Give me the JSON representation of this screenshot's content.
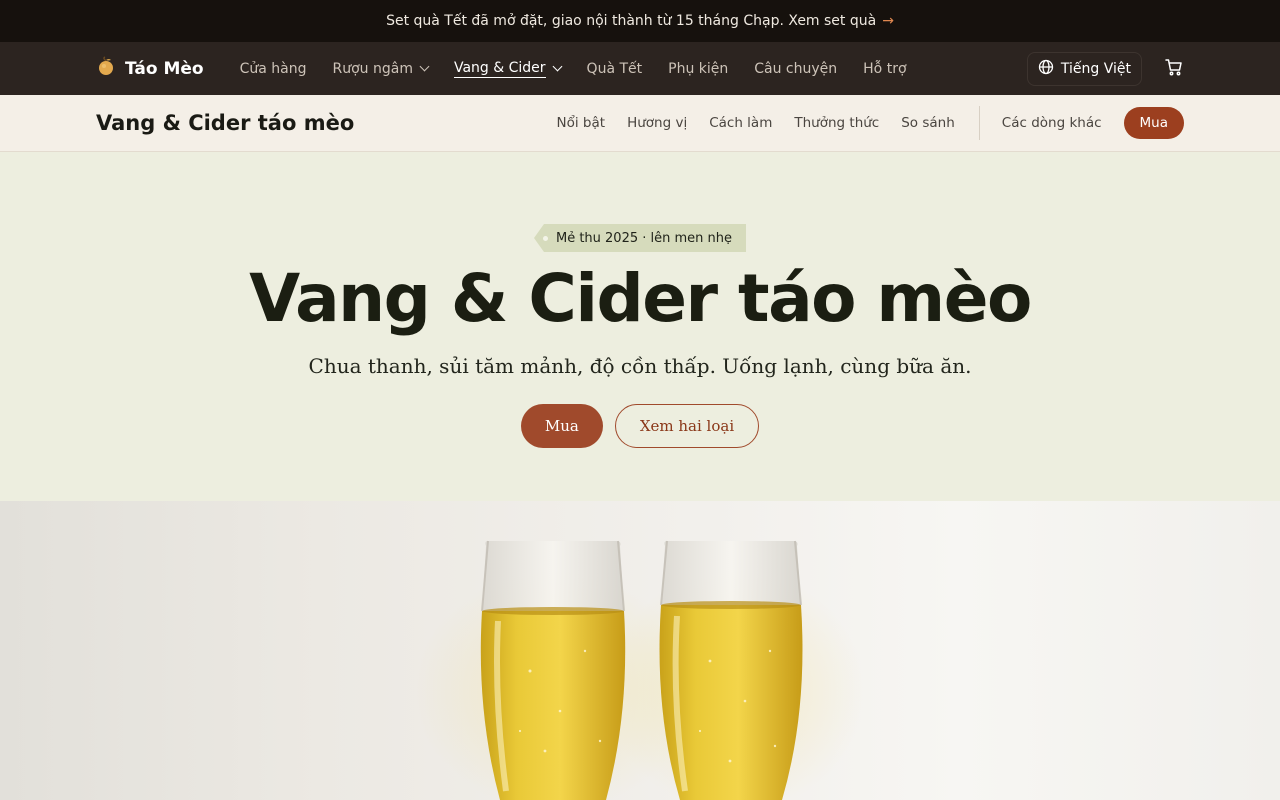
{
  "promo": {
    "text": "Set quà Tết đã mở đặt, giao nội thành từ 15 tháng Chạp. Xem set quà",
    "arrow": "→"
  },
  "brand": {
    "name": "Táo Mèo",
    "icon": "apple-icon"
  },
  "nav": {
    "items": [
      {
        "label": "Cửa hàng",
        "dropdown": false,
        "active": false
      },
      {
        "label": "Rượu ngâm",
        "dropdown": true,
        "active": false
      },
      {
        "label": "Vang & Cider",
        "dropdown": true,
        "active": true
      },
      {
        "label": "Quà Tết",
        "dropdown": false,
        "active": false
      },
      {
        "label": "Phụ kiện",
        "dropdown": false,
        "active": false
      },
      {
        "label": "Câu chuyện",
        "dropdown": false,
        "active": false
      },
      {
        "label": "Hỗ trợ",
        "dropdown": false,
        "active": false
      }
    ],
    "language": "Tiếng Việt",
    "language_icon": "globe-icon",
    "cart_icon": "cart-icon"
  },
  "subnav": {
    "title": "Vang & Cider táo mèo",
    "links": [
      "Nổi bật",
      "Hương vị",
      "Cách làm",
      "Thưởng thức",
      "So sánh"
    ],
    "other": "Các dòng khác",
    "buy": "Mua"
  },
  "hero": {
    "tag": "Mẻ thu 2025 · lên men nhẹ",
    "title": "Vang & Cider táo mèo",
    "subtitle": "Chua thanh, sủi tăm mảnh, độ cồn thấp. Uống lạnh, cùng bữa ăn.",
    "primary_button": "Mua",
    "secondary_button": "Xem hai loại"
  },
  "colors": {
    "promo_bg": "#16110d",
    "nav_bg": "#2c2420",
    "subnav_bg": "#f4efe7",
    "hero_bg": "#edeedf",
    "accent": "#a04a2c",
    "tag_bg": "#d6dbbc"
  }
}
